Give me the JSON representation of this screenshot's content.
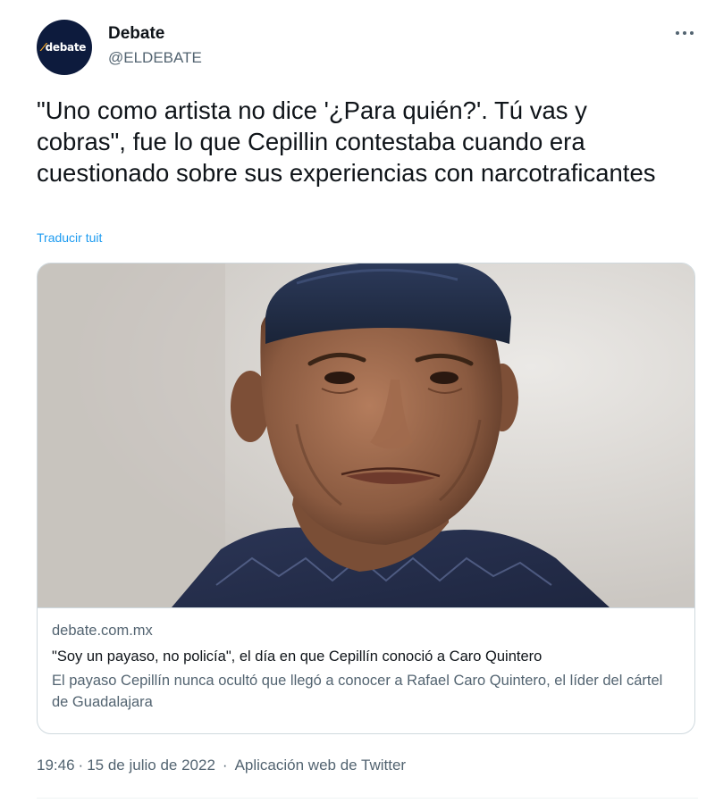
{
  "account": {
    "display_name": "Debate",
    "handle": "@ELDEBATE",
    "avatar_text": "debate"
  },
  "tweet": {
    "text": "\"Uno como artista no dice '¿Para quién?'. Tú vas y cobras\", fue lo que Cepillin contestaba cuando era cuestionado sobre sus experiencias con narcotraficantes",
    "translate_label": "Traducir tuit"
  },
  "card": {
    "domain": "debate.com.mx",
    "title": "\"Soy un payaso, no policía\", el día en que Cepillín conoció a Caro Quintero",
    "description": "El payaso Cepillín nunca ocultó que llegó a conocer a Rafael Caro Quintero, el líder del cártel de Guadalajara",
    "image_icon": "photo-of-man-in-cap"
  },
  "meta": {
    "time": "19:46",
    "date": "15 de julio de 2022",
    "separator_1": "·",
    "separator_2": "·",
    "app": "Aplicación web de Twitter"
  },
  "icons": {
    "more": "more-horizontal-icon"
  },
  "colors": {
    "link": "#1d9bf0",
    "secondary_text": "#536471",
    "primary_text": "#0f1419",
    "border": "#cfd9de",
    "avatar_bg": "#0d1b3d",
    "avatar_accent": "#f5a623"
  }
}
